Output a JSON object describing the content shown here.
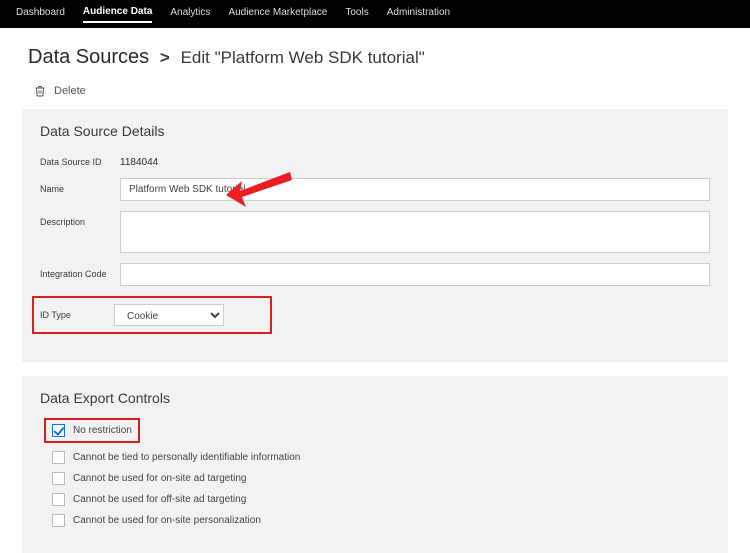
{
  "nav": {
    "items": [
      "Dashboard",
      "Audience Data",
      "Analytics",
      "Audience Marketplace",
      "Tools",
      "Administration"
    ],
    "activeIndex": 1
  },
  "breadcrumb": {
    "root": "Data Sources",
    "separator": ">",
    "leaf": "Edit \"Platform Web SDK tutorial\""
  },
  "actions": {
    "delete": "Delete"
  },
  "details": {
    "title": "Data Source Details",
    "labels": {
      "id": "Data Source ID",
      "name": "Name",
      "description": "Description",
      "integrationCode": "Integration Code",
      "idType": "ID Type"
    },
    "id": "1184044",
    "name": "Platform Web SDK tutorial",
    "description": "",
    "integrationCode": "",
    "idType": "Cookie"
  },
  "export": {
    "title": "Data Export Controls",
    "options": [
      {
        "label": "No restriction",
        "checked": true
      },
      {
        "label": "Cannot be tied to personally identifiable information",
        "checked": false
      },
      {
        "label": "Cannot be used for on-site ad targeting",
        "checked": false
      },
      {
        "label": "Cannot be used for off-site ad targeting",
        "checked": false
      },
      {
        "label": "Cannot be used for on-site personalization",
        "checked": false
      }
    ]
  },
  "annotations": {
    "arrowColor": "#ec1c24",
    "highlightColor": "#d6201f"
  }
}
